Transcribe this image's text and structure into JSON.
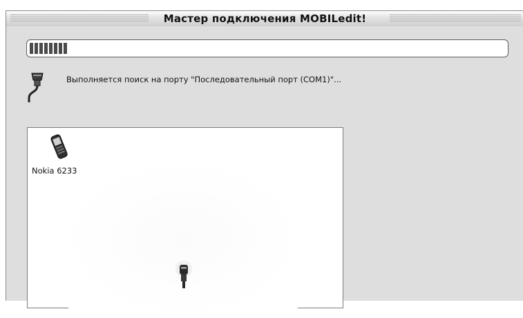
{
  "window": {
    "title": "Мастер подключения MOBILedit!"
  },
  "progress": {
    "fraction": 0.08
  },
  "status": {
    "icon": "serial-port-icon",
    "text": "Выполняется поиск на порту \"Последовательный порт (COM1)\"..."
  },
  "devices": {
    "items": [
      {
        "icon": "mobile-phone-icon",
        "label": "Nokia 6233"
      }
    ],
    "connector_icon": "usb-connector-icon"
  },
  "colors": {
    "client_bg": "#dedede",
    "progress_fill": "#4a4a4a"
  }
}
